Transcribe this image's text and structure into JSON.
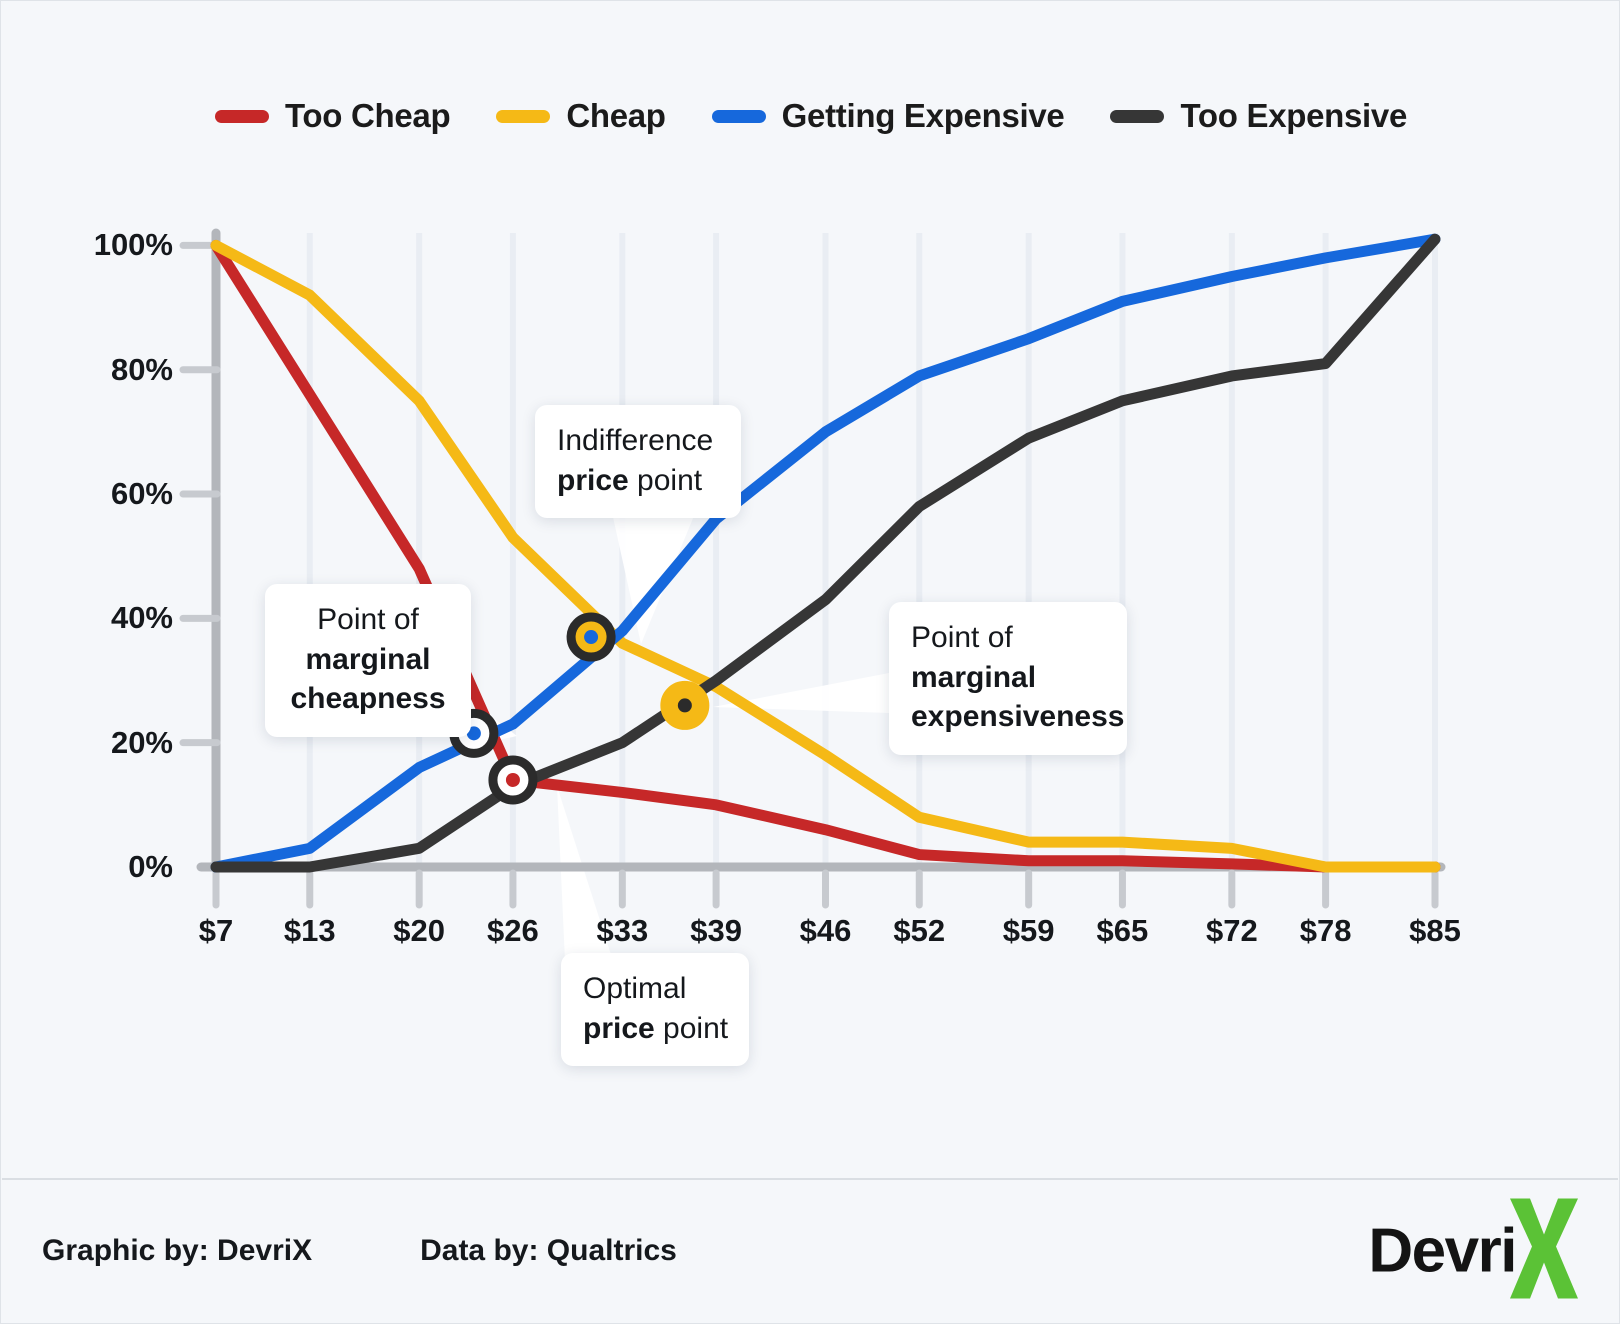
{
  "legend": {
    "items": [
      {
        "label": "Too Cheap",
        "color": "#C62828"
      },
      {
        "label": "Cheap",
        "color": "#F5B916"
      },
      {
        "label": "Getting Expensive",
        "color": "#1668DC"
      },
      {
        "label": "Too Expensive",
        "color": "#363636"
      }
    ]
  },
  "footer": {
    "graphic_credit": "Graphic by: DevriX",
    "data_credit": "Data by: Qualtrics",
    "logo_text": "Devri",
    "logo_mark": "X",
    "logo_mark_color": "#5BC236"
  },
  "callouts": {
    "marginal_cheapness": {
      "line1": "Point of",
      "line2": "marginal",
      "line3": "cheapness"
    },
    "indifference": {
      "line1": "Indifference",
      "line2_bold": "price",
      "line2_rest": " point"
    },
    "marginal_expensiveness": {
      "line1": "Point of",
      "line2": "marginal",
      "line3": "expensiveness"
    },
    "optimal": {
      "line1": "Optimal",
      "line2_bold": "price",
      "line2_rest": " point"
    }
  },
  "chart_data": {
    "type": "line",
    "title": "",
    "xlabel": "",
    "ylabel": "",
    "grid": "vertical",
    "legend_position": "top",
    "xlim": [
      7,
      85
    ],
    "ylim": [
      0,
      1.02
    ],
    "x_tick_labels": [
      "$7",
      "$13",
      "$20",
      "$26",
      "$33",
      "$39",
      "$46",
      "$52",
      "$59",
      "$65",
      "$72",
      "$78",
      "$85"
    ],
    "y_tick_labels": [
      "0%",
      "20%",
      "40%",
      "60%",
      "80%",
      "100%"
    ],
    "y_tick_values": [
      0,
      20,
      40,
      60,
      80,
      100
    ],
    "x": [
      7,
      13,
      20,
      26,
      33,
      39,
      46,
      52,
      59,
      65,
      72,
      78,
      85
    ],
    "series": [
      {
        "name": "Too Cheap",
        "color": "#C62828",
        "values": [
          100,
          76,
          48,
          14,
          12,
          10,
          6,
          2,
          1,
          1,
          0.5,
          0,
          0
        ]
      },
      {
        "name": "Cheap",
        "color": "#F5B916",
        "values": [
          100,
          92,
          75,
          53,
          36,
          29,
          18,
          8,
          4,
          4,
          3,
          0,
          0
        ]
      },
      {
        "name": "Getting Expensive",
        "color": "#1668DC",
        "values": [
          0,
          3,
          16,
          23,
          38,
          56,
          70,
          79,
          85,
          91,
          95,
          98,
          101
        ]
      },
      {
        "name": "Too Expensive",
        "color": "#363636",
        "values": [
          0,
          0,
          3,
          13,
          20,
          30,
          43,
          58,
          69,
          75,
          79,
          81,
          101
        ]
      }
    ],
    "markers": [
      {
        "name": "Point of marginal cheapness",
        "x": 23.5,
        "y": 21.5,
        "ring": "#2b2b2b",
        "fill": "#ffffff",
        "dot": "#1668DC"
      },
      {
        "name": "Optimal price point",
        "x": 26,
        "y": 14,
        "ring": "#2b2b2b",
        "fill": "#ffffff",
        "dot": "#C62828"
      },
      {
        "name": "Indifference price point",
        "x": 31,
        "y": 37,
        "ring": "#2b2b2b",
        "fill": "#F5B916",
        "dot": "#1668DC"
      },
      {
        "name": "Point of marginal expensiveness",
        "x": 37,
        "y": 26,
        "ring": "#F5B916",
        "fill": "#F5B916",
        "dot": "#2b2b2b"
      }
    ]
  }
}
